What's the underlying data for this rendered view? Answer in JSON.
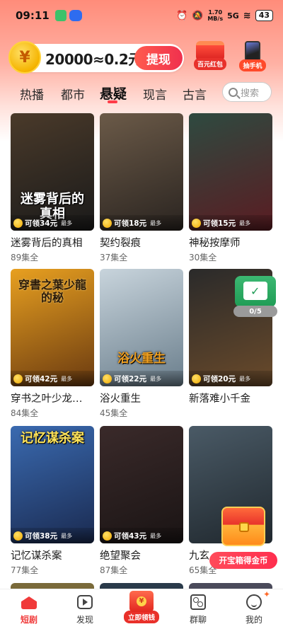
{
  "status_bar": {
    "time": "09:11",
    "net_speed_value": "1.70",
    "net_speed_unit": "MB/s",
    "network": "5G",
    "battery": "43"
  },
  "coin_banner": {
    "coin_text": "20000≈0.2元",
    "withdraw_label": "提现"
  },
  "promos": {
    "red_packet_label": "百元红包",
    "phone_label": "抽手机"
  },
  "tabs": [
    "热播",
    "都市",
    "悬疑",
    "现言",
    "古言"
  ],
  "active_tab": "悬疑",
  "search": {
    "placeholder": "搜索"
  },
  "grid": [
    {
      "title": "迷雾背后的真相",
      "episodes": "89集全",
      "reward": "可领34元",
      "reward_suffix": "最多",
      "poster_text": "迷雾背后的真相",
      "colors": [
        "#4a3a2a",
        "#1a1a1a"
      ]
    },
    {
      "title": "契约裂痕",
      "episodes": "37集全",
      "reward": "可领18元",
      "reward_suffix": "最多",
      "poster_text": "",
      "colors": [
        "#6b5a48",
        "#2a2420"
      ]
    },
    {
      "title": "神秘按摩师",
      "episodes": "30集全",
      "reward": "可领15元",
      "reward_suffix": "最多",
      "poster_text": "",
      "colors": [
        "#2e4a40",
        "#5a1c22"
      ]
    },
    {
      "title": "穿书之叶少龙…",
      "episodes": "84集全",
      "reward": "可领42元",
      "reward_suffix": "最多",
      "poster_text": "穿書之葉少龍的秘",
      "colors": [
        "#e8a020",
        "#6a3a10"
      ]
    },
    {
      "title": "浴火重生",
      "episodes": "45集全",
      "reward": "可领22元",
      "reward_suffix": "最多",
      "poster_text": "浴火重生",
      "colors": [
        "#c8d4dc",
        "#6a7e8c"
      ]
    },
    {
      "title": "新落难小千金",
      "episodes": "",
      "reward": "可领20元",
      "reward_suffix": "最多",
      "poster_text": "",
      "colors": [
        "#2a2a2a",
        "#6a4a2a"
      ]
    },
    {
      "title": "记忆谋杀案",
      "episodes": "77集全",
      "reward": "可领38元",
      "reward_suffix": "最多",
      "poster_text": "记忆谋杀案",
      "colors": [
        "#3a6ab0",
        "#1a2a50"
      ]
    },
    {
      "title": "绝望聚会",
      "episodes": "87集全",
      "reward": "可领43元",
      "reward_suffix": "最多",
      "poster_text": "",
      "colors": [
        "#3a2a2a",
        "#1a1414"
      ]
    },
    {
      "title": "九玄",
      "episodes": "65集全",
      "reward": "",
      "reward_suffix": "",
      "poster_text": "",
      "colors": [
        "#4a5a66",
        "#20282e"
      ]
    }
  ],
  "float_widget": {
    "progress": "0/5"
  },
  "chest": {
    "label": "开宝箱得金币"
  },
  "bottom_nav": {
    "items": [
      "短剧",
      "发现",
      "立即领钱",
      "群聊",
      "我的"
    ],
    "active": "短剧"
  },
  "colors": {
    "accent": "#f03a3a",
    "banner_top": "#ff8c7a"
  }
}
